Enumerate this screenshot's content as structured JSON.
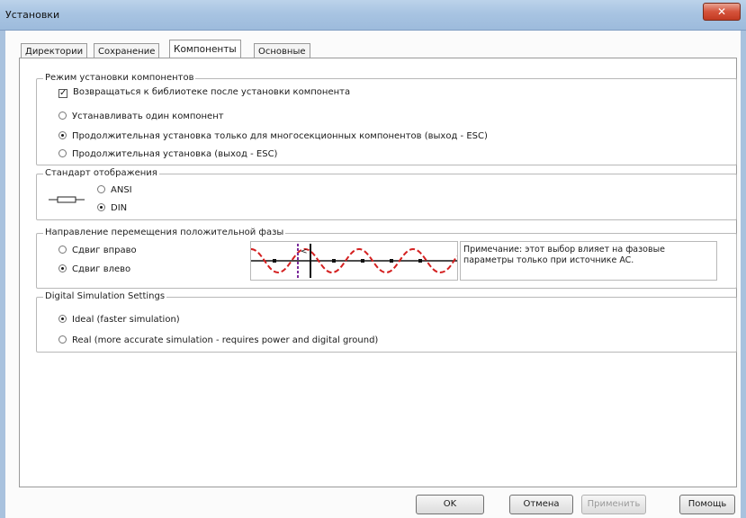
{
  "window": {
    "title": "Установки",
    "close_glyph": "✕"
  },
  "tabs": [
    {
      "label": "Директории"
    },
    {
      "label": "Сохранение"
    },
    {
      "label": "Компоненты"
    },
    {
      "label": "Основные"
    }
  ],
  "group_install": {
    "legend": "Режим установки компонентов",
    "return_checkbox": "Возвращаться к библиотеке после установки компонента",
    "options": [
      "Устанавливать один компонент",
      "Продолжительная установка только для многосекционных компонентов (выход - ESC)",
      "Продолжительная установка (выход - ESC)"
    ]
  },
  "group_standard": {
    "legend": "Стандарт отображения",
    "options": [
      "ANSI",
      "DIN"
    ]
  },
  "group_phase": {
    "legend": "Направление перемещения положительной фазы",
    "options": [
      "Сдвиг вправо",
      "Сдвиг влево"
    ],
    "wave_marker": "<",
    "note": "Примечание: этот выбор влияет на фазовые параметры только при источнике AC."
  },
  "group_digital": {
    "legend": "Digital Simulation Settings",
    "options": [
      "Ideal (faster simulation)",
      "Real (more accurate simulation - requires power and digital ground)"
    ]
  },
  "buttons": {
    "ok": "OK",
    "cancel": "Отмена",
    "apply": "Применить",
    "help": "Помощь"
  },
  "colors": {
    "wave": "#d42020",
    "marker": "#7a2a9a"
  }
}
